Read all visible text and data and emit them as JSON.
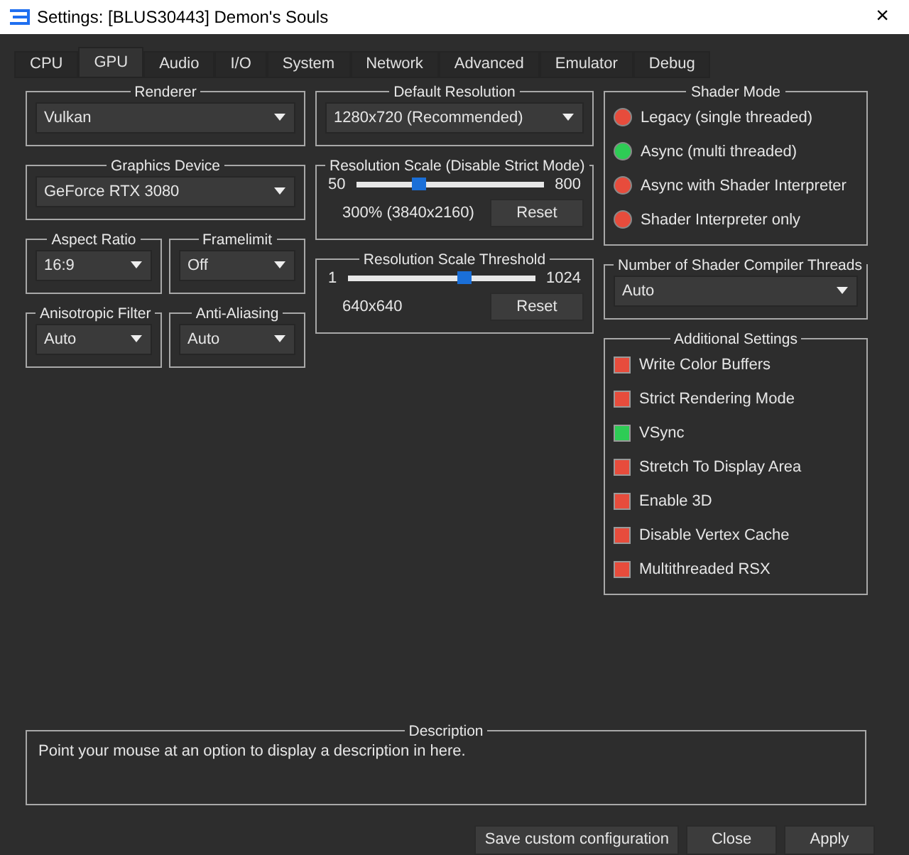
{
  "window": {
    "title": "Settings: [BLUS30443] Demon's Souls",
    "close": "×"
  },
  "tabs": [
    {
      "label": "CPU",
      "selected": false
    },
    {
      "label": "GPU",
      "selected": true
    },
    {
      "label": "Audio",
      "selected": false
    },
    {
      "label": "I/O",
      "selected": false
    },
    {
      "label": "System",
      "selected": false
    },
    {
      "label": "Network",
      "selected": false
    },
    {
      "label": "Advanced",
      "selected": false
    },
    {
      "label": "Emulator",
      "selected": false
    },
    {
      "label": "Debug",
      "selected": false
    }
  ],
  "renderer": {
    "title": "Renderer",
    "value": "Vulkan"
  },
  "graphics_device": {
    "title": "Graphics Device",
    "value": "GeForce RTX 3080"
  },
  "aspect_ratio": {
    "title": "Aspect Ratio",
    "value": "16:9"
  },
  "framelimit": {
    "title": "Framelimit",
    "value": "Off"
  },
  "anisotropic_filter": {
    "title": "Anisotropic Filter",
    "value": "Auto"
  },
  "anti_aliasing": {
    "title": "Anti-Aliasing",
    "value": "Auto"
  },
  "default_resolution": {
    "title": "Default Resolution",
    "value": "1280x720 (Recommended)"
  },
  "resolution_scale": {
    "title": "Resolution Scale (Disable Strict Mode)",
    "min": "50",
    "max": "800",
    "level": 0.333,
    "reading": "300% (3840x2160)",
    "button": "Reset"
  },
  "resolution_scale_threshold": {
    "title": "Resolution Scale Threshold",
    "min": "1",
    "max": "1024",
    "level": 0.625,
    "reading": "640x640",
    "button": "Reset"
  },
  "shader_mode": {
    "title": "Shader Mode",
    "options": [
      {
        "label": "Legacy (single threaded)",
        "selected": false
      },
      {
        "label": "Async (multi threaded)",
        "selected": true
      },
      {
        "label": "Async with Shader Interpreter",
        "selected": false
      },
      {
        "label": "Shader Interpreter only",
        "selected": false
      }
    ]
  },
  "shader_compiler_threads": {
    "title": "Number of Shader Compiler Threads",
    "value": "Auto"
  },
  "additional_settings": {
    "title": "Additional Settings",
    "options": [
      {
        "label": "Write Color Buffers",
        "checked": false
      },
      {
        "label": "Strict Rendering Mode",
        "checked": false
      },
      {
        "label": "VSync",
        "checked": true
      },
      {
        "label": "Stretch To Display Area",
        "checked": false
      },
      {
        "label": "Enable 3D",
        "checked": false
      },
      {
        "label": "Disable Vertex Cache",
        "checked": false
      },
      {
        "label": "Multithreaded RSX",
        "checked": false
      }
    ]
  },
  "description": {
    "title": "Description",
    "text": "Point your mouse at an option to display a description in here."
  },
  "buttons": [
    "Save custom configuration",
    "Close",
    "Apply"
  ]
}
